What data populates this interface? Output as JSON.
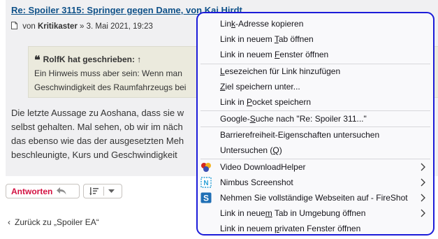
{
  "post": {
    "title": "Re: Spoiler 3115: Springer gegen Dame, von Kai Hirdt",
    "meta_prefix": "von",
    "author": "Kritikaster",
    "meta_suffix": "» 3. Mai 2021, 19:23",
    "quote": {
      "header": "RolfK hat geschrieben: ↑",
      "lines": [
        "Ein Hinweis muss aber sein: Wenn man",
        "Geschwindigkeit des Raumfahrzeugs bei"
      ]
    },
    "body_lines": [
      "Die letzte Aussage zu Aoshana, dass sie w",
      "selbst gehalten. Mal sehen, ob wir im näch",
      "das ebenso wie das der ausgesetzten Meh",
      "beschleunigte, Kurs und Geschwindigkeit"
    ]
  },
  "actions": {
    "reply_label": "Antworten",
    "back_label": "Zurück zu „Spoiler EA“"
  },
  "context_menu": {
    "items": [
      {
        "pre": "Lin",
        "acc": "k",
        "post": "-Adresse kopieren"
      },
      {
        "pre": "Link in neuem ",
        "acc": "T",
        "post": "ab öffnen"
      },
      {
        "pre": "Link in neuem ",
        "acc": "F",
        "post": "enster öffnen"
      },
      {
        "pre": "",
        "acc": "L",
        "post": "esezeichen für Link hinzufügen"
      },
      {
        "pre": "",
        "acc": "Z",
        "post": "iel speichern unter..."
      },
      {
        "pre": "Link in ",
        "acc": "P",
        "post": "ocket speichern"
      },
      {
        "pre": "Google-",
        "acc": "S",
        "post": "uche nach \"Re: Spoiler 311...\""
      },
      {
        "pre": "Barrierefreiheit-Eigenschaften untersuchen",
        "acc": "",
        "post": ""
      },
      {
        "pre": "Untersuchen (",
        "acc": "Q",
        "post": ")"
      },
      {
        "pre": "Video DownloadHelper",
        "acc": "",
        "post": ""
      },
      {
        "pre": "Nimbus Screenshot",
        "acc": "",
        "post": ""
      },
      {
        "pre": "Nehmen Sie vollständige Webseiten auf - FireShot",
        "acc": "",
        "post": ""
      },
      {
        "pre": "Link in neue",
        "acc": "m",
        "post": " Tab in Umgebung öffnen"
      },
      {
        "pre": "Link in neuem ",
        "acc": "p",
        "post": "rivaten Fenster öffnen"
      }
    ],
    "icons": [
      "video-downloadhelper-icon",
      "nimbus-screenshot-icon",
      "fireshot-icon"
    ]
  },
  "colors": {
    "title_link": "#105289",
    "reply_red": "#d31141",
    "menu_border": "#1c1cd9",
    "post_bg": "#f0f0f2",
    "quote_bg": "#ebeadd"
  }
}
